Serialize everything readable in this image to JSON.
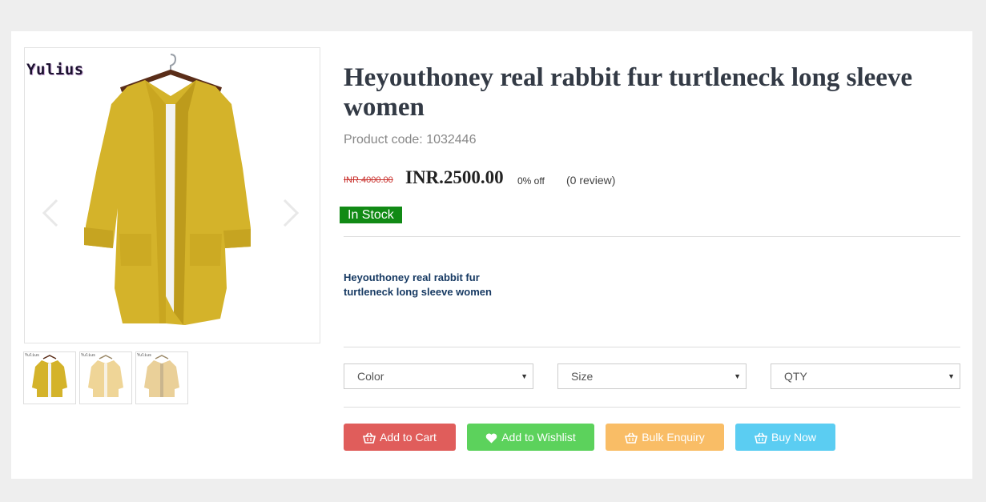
{
  "product": {
    "brand_mark": "Yulius",
    "title": "Heyouthoney real rabbit fur turtleneck long sleeve women",
    "code_label": "Product code:",
    "code_value": "1032446",
    "old_price": "INR.4000.00",
    "price": "INR.2500.00",
    "discount": "0% off",
    "review": "(0 review)",
    "stock": "In Stock",
    "description": "Heyouthoney real rabbit fur turtleneck long sleeve women"
  },
  "gallery": {
    "prev_icon": "chevron-left-icon",
    "next_icon": "chevron-right-icon",
    "thumbnails": [
      {
        "label": "Yulius",
        "color": "#d4b32a"
      },
      {
        "label": "Yulius",
        "color": "#efd597"
      },
      {
        "label": "Yulius",
        "color": "#ead099"
      }
    ]
  },
  "options": {
    "color": "Color",
    "size": "Size",
    "qty": "QTY"
  },
  "actions": {
    "add_to_cart": "Add to Cart",
    "add_to_wishlist": "Add to Wishlist",
    "bulk_enquiry": "Bulk Enquiry",
    "buy_now": "Buy Now"
  },
  "colors": {
    "stock_badge": "#118a15",
    "cart": "#e05d5b",
    "wishlist": "#5cd25c",
    "bulk": "#f9bd66",
    "buy": "#5bcdf2",
    "product": "#d4b32a"
  }
}
